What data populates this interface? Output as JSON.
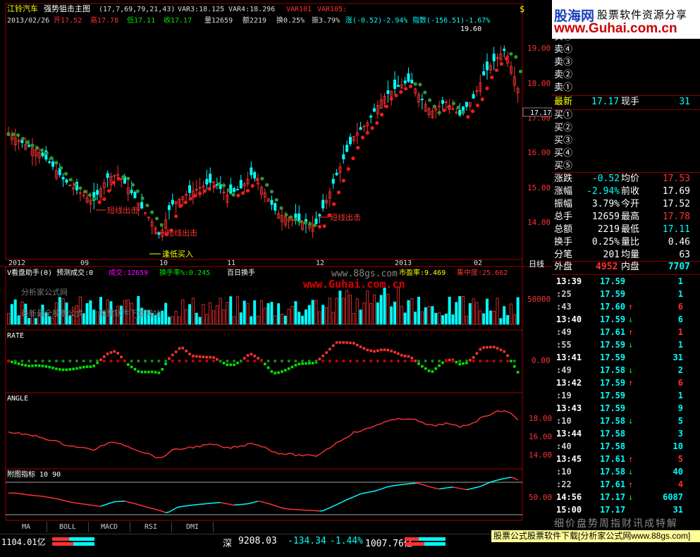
{
  "header": {
    "name": "江铃汽车",
    "indicator": "强势狙击主图",
    "params": "(17,7,69,79,21,43)",
    "var3": "VAR3:18.125",
    "var4": "VAR4:18.296",
    "var101": "VAR101",
    "var105": "VAR105:",
    "date": "2013/02/26",
    "open": "开17.52",
    "high": "高17.78",
    "low": "低17.11",
    "close": "收17.17",
    "vol": "量12659",
    "amt": "额2219",
    "turn": "换0.25%",
    "amp": "振3.79%",
    "chg": "涨(-0.52)-2.94%",
    "idx": "指数(-156.51)-1.67%"
  },
  "main_chart": {
    "y_labels": [
      "19.00",
      "18.00",
      "17.00",
      "16.00",
      "15.00",
      "14.00"
    ],
    "peak_label": "19.60",
    "current_price_tag": "17.17",
    "signal_labels": [
      "短线出击",
      "短线出击",
      "短线出击",
      "逢低买入"
    ],
    "date_labels": [
      "2012",
      "09",
      "10",
      "11",
      "12",
      "2013",
      "02"
    ],
    "period": "日线"
  },
  "volume_panel": {
    "title": "V看盘助手(0) 预测成交:0",
    "cj": "成交:12659",
    "hsl": "换手率%:0.245",
    "bai": "百日换手",
    "syl": "市盈率:9.469",
    "jzd": "集中度:25.662",
    "wm1": "分析家公式网",
    "wm2": "最新最全股票公式",
    "wm3": "股票软件下载网站",
    "wm4": "www.88gs.com",
    "wm5": "www.Guhai.com.cn",
    "y_label": "50000"
  },
  "rate_panel": {
    "title": "RATE",
    "y_label": "0.00"
  },
  "angle_panel": {
    "title": "ANGLE",
    "y_labels": [
      "18.00",
      "16.00",
      "14.00"
    ]
  },
  "aux_panel": {
    "title": "附图指标  10 90",
    "y_label": "50.00"
  },
  "right_panel": {
    "logo1": "股海网",
    "logo2": "股票软件资源分享",
    "logo3": "www.Guhai.com.cn",
    "sell_levels": [
      "卖⑤",
      "卖④",
      "卖③",
      "卖②",
      "卖①"
    ],
    "latest": {
      "label": "最新",
      "value": "17.17",
      "label2": "现手",
      "value2": "31"
    },
    "buy_levels": [
      "买①",
      "买②",
      "买③",
      "买④",
      "买⑤"
    ],
    "stats": [
      {
        "l1": "涨跌",
        "v1": "-0.52",
        "l2": "均价",
        "v2": "17.53"
      },
      {
        "l1": "涨幅",
        "v1": "-2.94%",
        "l2": "前收",
        "v2": "17.69"
      },
      {
        "l1": "振幅",
        "v1": "3.79%",
        "l2": "今开",
        "v2": "17.52"
      },
      {
        "l1": "总手",
        "v1": "12659",
        "l2": "最高",
        "v2": "17.78"
      },
      {
        "l1": "总额",
        "v1": "2219",
        "l2": "最低",
        "v2": "17.11"
      },
      {
        "l1": "换手",
        "v1": "0.25%",
        "l2": "量比",
        "v2": "0.46"
      },
      {
        "l1": "分笔",
        "v1": "201",
        "l2": "均量",
        "v2": "63"
      }
    ],
    "outer": {
      "label": "外盘",
      "value": "4952",
      "label2": "内盘",
      "value2": "7707"
    },
    "ticks": [
      {
        "t": "13:39",
        "p": "17.59",
        "a": "",
        "v": "1"
      },
      {
        "t": ":25",
        "p": "17.59",
        "a": "",
        "v": "1"
      },
      {
        "t": ":43",
        "p": "17.60",
        "a": "↑",
        "v": "6"
      },
      {
        "t": "13:40",
        "p": "17.59",
        "a": "↓",
        "v": "6"
      },
      {
        "t": ":49",
        "p": "17.61",
        "a": "↑",
        "v": "1"
      },
      {
        "t": ":55",
        "p": "17.59",
        "a": "↓",
        "v": "1"
      },
      {
        "t": "13:41",
        "p": "17.59",
        "a": "",
        "v": "31"
      },
      {
        "t": ":49",
        "p": "17.58",
        "a": "↓",
        "v": "2"
      },
      {
        "t": "13:42",
        "p": "17.59",
        "a": "↑",
        "v": "6"
      },
      {
        "t": ":19",
        "p": "17.59",
        "a": "",
        "v": "1"
      },
      {
        "t": "13:43",
        "p": "17.59",
        "a": "",
        "v": "9"
      },
      {
        "t": ":10",
        "p": "17.58",
        "a": "↓",
        "v": "5"
      },
      {
        "t": "13:44",
        "p": "17.58",
        "a": "",
        "v": "3"
      },
      {
        "t": ":40",
        "p": "17.58",
        "a": "",
        "v": "10"
      },
      {
        "t": "13:45",
        "p": "17.61",
        "a": "↑",
        "v": "5"
      },
      {
        "t": ":10",
        "p": "17.58",
        "a": "↓",
        "v": "40"
      },
      {
        "t": ":22",
        "p": "17.61",
        "a": "↑",
        "v": "4"
      },
      {
        "t": "14:56",
        "p": "17.17",
        "a": "↓",
        "v": "6087"
      },
      {
        "t": "15:00",
        "p": "17.17",
        "a": "",
        "v": "31"
      }
    ],
    "bottom_tabs": "细价盘势周指财讯成特解"
  },
  "bottom_tabs": [
    "MA",
    "BOLL",
    "MACD",
    "RSI",
    "DMI"
  ],
  "status": {
    "sh": "1104.01亿",
    "sz_label": "深",
    "sz_index": "9208.03",
    "sz_chg": "-134.34",
    "sz_pct": "-1.44%",
    "sz_amt": "1007.76亿",
    "ad_text": "股票公式股票软件下载[分析家公式网www.88gs.com]"
  },
  "colors": {
    "up": "#ff3232",
    "down": "#00ffff",
    "grid": "#800000",
    "green_dot": "#2e8b2e",
    "red_dot": "#ff0000"
  }
}
